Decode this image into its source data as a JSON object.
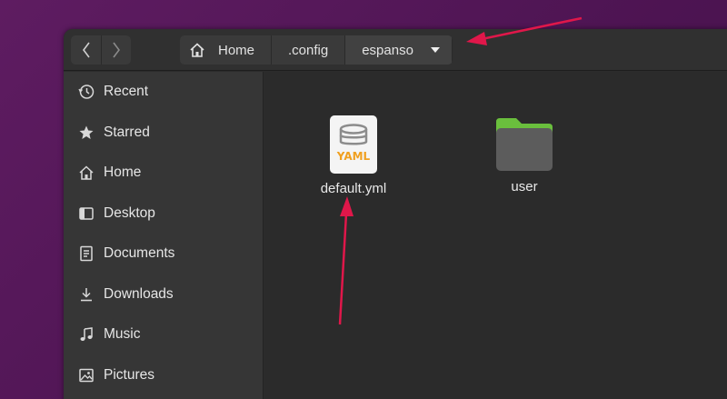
{
  "nav": {
    "back_icon": "chevron-left-icon",
    "forward_icon": "chevron-right-icon"
  },
  "breadcrumbs": [
    {
      "label": "Home",
      "icon": "home-icon"
    },
    {
      "label": ".config"
    },
    {
      "label": "espanso",
      "icon": "caret-down-icon"
    }
  ],
  "sidebar": {
    "items": [
      {
        "label": "Recent",
        "icon": "clock-icon"
      },
      {
        "label": "Starred",
        "icon": "star-icon"
      },
      {
        "label": "Home",
        "icon": "home-icon"
      },
      {
        "label": "Desktop",
        "icon": "desktop-icon"
      },
      {
        "label": "Documents",
        "icon": "document-icon"
      },
      {
        "label": "Downloads",
        "icon": "download-icon"
      },
      {
        "label": "Music",
        "icon": "music-icon"
      },
      {
        "label": "Pictures",
        "icon": "picture-icon"
      }
    ]
  },
  "files": [
    {
      "name": "default.yml",
      "type": "yaml",
      "icon_text": "YAML",
      "icon": "yaml-file-icon"
    },
    {
      "name": "user",
      "type": "folder",
      "icon": "folder-icon"
    }
  ],
  "colors": {
    "annotation_arrow": "#e0174a",
    "folder_tab": "#6abf3d",
    "folder_body": "#5a5a5a",
    "yaml_accent": "#f0a020"
  }
}
